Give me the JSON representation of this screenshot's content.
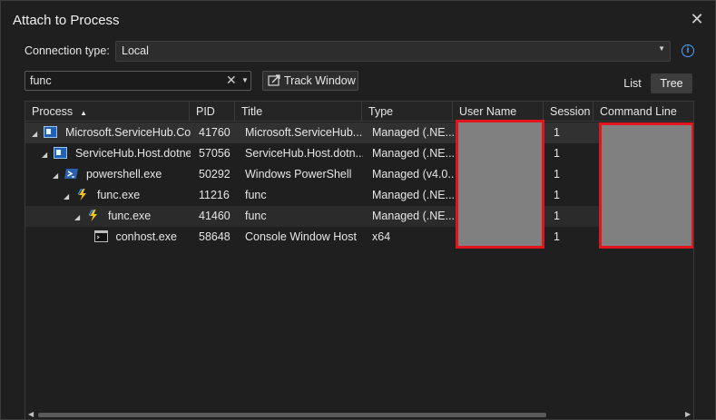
{
  "window": {
    "title": "Attach to Process"
  },
  "connection": {
    "label": "Connection type:",
    "value": "Local"
  },
  "filter": {
    "value": "func"
  },
  "toolbar": {
    "track_window": "Track Window"
  },
  "view": {
    "list": "List",
    "tree": "Tree",
    "selected": "Tree"
  },
  "columns": [
    "Process",
    "PID",
    "Title",
    "Type",
    "User Name",
    "Session",
    "Command Line"
  ],
  "rows": [
    {
      "process": "Microsoft.ServiceHub.Co...",
      "pid": "41760",
      "title": "Microsoft.ServiceHub....",
      "type": "Managed (.NE...",
      "session": "1",
      "icon": "service-icon"
    },
    {
      "process": "ServiceHub.Host.dotnet...",
      "pid": "57056",
      "title": "ServiceHub.Host.dotn...",
      "type": "Managed (.NE...",
      "session": "1",
      "icon": "service-icon"
    },
    {
      "process": "powershell.exe",
      "pid": "50292",
      "title": "Windows PowerShell",
      "type": "Managed (v4.0...",
      "session": "1",
      "icon": "powershell-icon"
    },
    {
      "process": "func.exe",
      "pid": "11216",
      "title": "func",
      "type": "Managed (.NE...",
      "session": "1",
      "icon": "lightning-icon"
    },
    {
      "process": "func.exe",
      "pid": "41460",
      "title": "func",
      "type": "Managed (.NE...",
      "session": "1",
      "icon": "lightning-icon"
    },
    {
      "process": "conhost.exe",
      "pid": "58648",
      "title": "Console Window Host",
      "type": "x64",
      "session": "1",
      "icon": "console-icon"
    }
  ],
  "colors": {
    "accent": "#4aa3ff",
    "redaction_border": "#e0161c",
    "redaction_fill": "#808080"
  }
}
